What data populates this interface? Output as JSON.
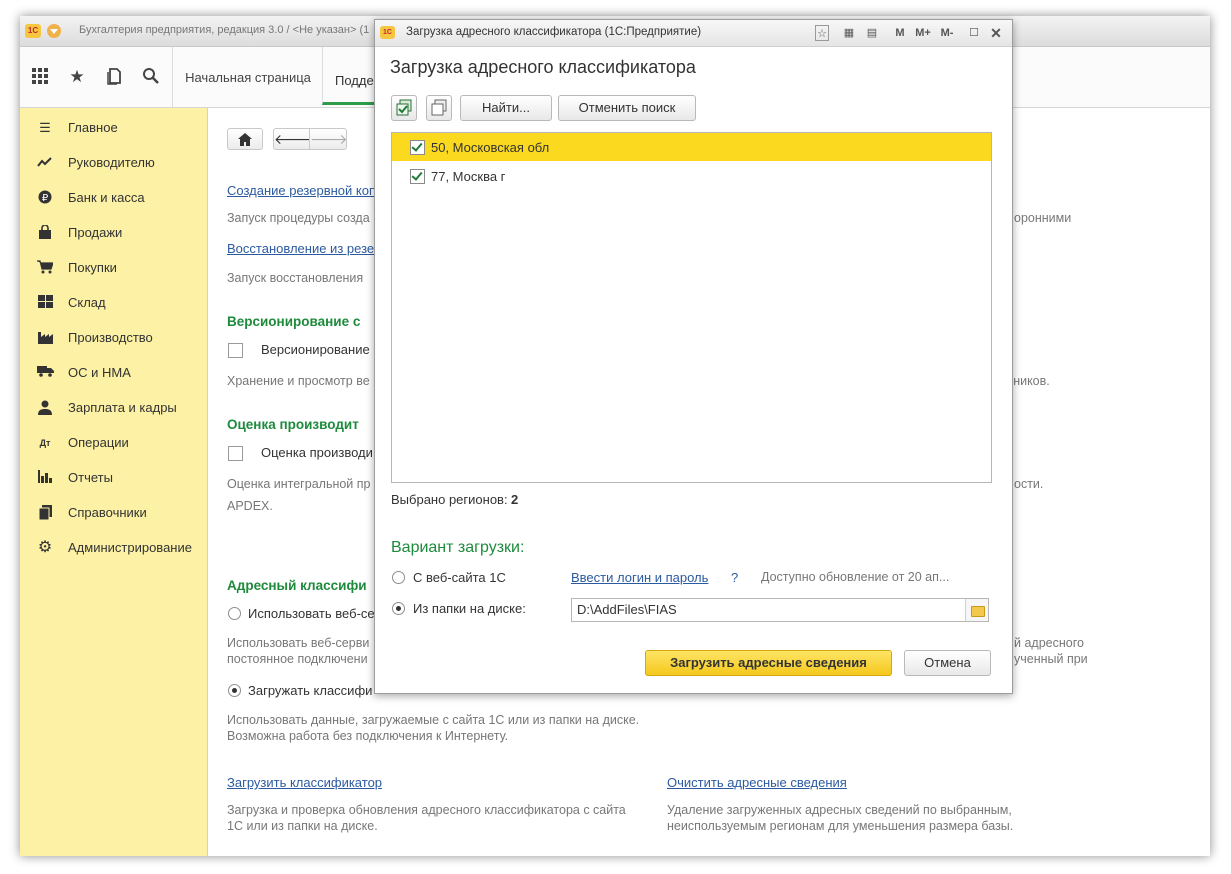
{
  "main_window": {
    "title": "Бухгалтерия предприятия, редакция 3.0 / <Не указан> (1",
    "logo_text": "1С",
    "tab_home": "Начальная страница",
    "tab_active": "Подде"
  },
  "toolbar_icons": [
    "apps-grid-icon",
    "star-icon",
    "history-icon",
    "search-icon"
  ],
  "sidebar": {
    "items": [
      {
        "label": "Главное",
        "icon": "menu-icon"
      },
      {
        "label": "Руководителю",
        "icon": "trend-icon"
      },
      {
        "label": "Банк и касса",
        "icon": "ruble-icon"
      },
      {
        "label": "Продажи",
        "icon": "bag-icon"
      },
      {
        "label": "Покупки",
        "icon": "cart-icon"
      },
      {
        "label": "Склад",
        "icon": "warehouse-icon"
      },
      {
        "label": "Производство",
        "icon": "factory-icon"
      },
      {
        "label": "ОС и НМА",
        "icon": "truck-icon"
      },
      {
        "label": "Зарплата и кадры",
        "icon": "person-icon"
      },
      {
        "label": "Операции",
        "icon": "dtkt-icon"
      },
      {
        "label": "Отчеты",
        "icon": "chart-icon"
      },
      {
        "label": "Справочники",
        "icon": "book-icon"
      },
      {
        "label": "Администрирование",
        "icon": "gear-icon"
      }
    ]
  },
  "content": {
    "link_backup": "Создание резервной коп",
    "hint_backup": "Запуск процедуры созда",
    "link_restore": "Восстановление из резе",
    "hint_restore": "Запуск восстановления",
    "section_versioning": "Версионирование с",
    "cb_versioning": "Версионирование",
    "hint_versioning": "Хранение и просмотр ве",
    "hint_versioning_right": "очников.",
    "hint_third_party": "оронними",
    "section_perf": "Оценка производит",
    "cb_perf": "Оценка производи",
    "hint_perf_1": "Оценка интегральной пр",
    "hint_perf_2": "APDEX.",
    "hint_perf_right": "ости.",
    "section_address": "Адресный классифи",
    "radio_webservice": "Использовать веб-се",
    "hint_webservice_1": "Использовать веб-серви",
    "hint_webservice_2": "постоянное подключени",
    "hint_webservice_right_1": "й адресного",
    "hint_webservice_right_2": "ученный при",
    "radio_load": "Загружать классифи",
    "hint_load_1": "Использовать данные, загружаемые с сайта 1С или из папки на диске.",
    "hint_load_2": "Возможна работа без подключения к Интернету.",
    "link_load_classifier": "Загрузить классификатор",
    "hint_load_classifier_1": "Загрузка и проверка обновления адресного классификатора с сайта",
    "hint_load_classifier_2": "1С или из папки на диске.",
    "link_clear": "Очистить адресные сведения",
    "hint_clear_1": "Удаление загруженных адресных сведений по выбранным,",
    "hint_clear_2": "неиспользуемым регионам для уменьшения размера базы."
  },
  "dialog": {
    "window_title": "Загрузка адресного классификатора  (1С:Предприятие)",
    "heading": "Загрузка адресного классификатора",
    "btn_find": "Найти...",
    "btn_cancel_search": "Отменить поиск",
    "regions": [
      {
        "label": "50, Московская обл",
        "checked": true,
        "selected": true
      },
      {
        "label": "77, Москва г",
        "checked": true,
        "selected": false
      }
    ],
    "selected_label": "Выбрано регионов:",
    "selected_count": "2",
    "variant_heading": "Вариант загрузки:",
    "option_web": "С веб-сайта 1С",
    "link_login": "Ввести логин и пароль",
    "help_mark": "?",
    "update_info": "Доступно обновление от 20 ап...",
    "option_folder": "Из папки на диске:",
    "folder_path": "D:\\AddFiles\\FIAS",
    "btn_load": "Загрузить адресные сведения",
    "btn_cancel": "Отмена",
    "titlebar_buttons": [
      "M",
      "M+",
      "M-"
    ]
  },
  "colors": {
    "sidebar_bg": "#fcf1a5",
    "selected_row": "#fbd91f",
    "section_green": "#1e8a3c",
    "link_blue": "#2c5aa0",
    "primary_button": "#f4c81c"
  }
}
